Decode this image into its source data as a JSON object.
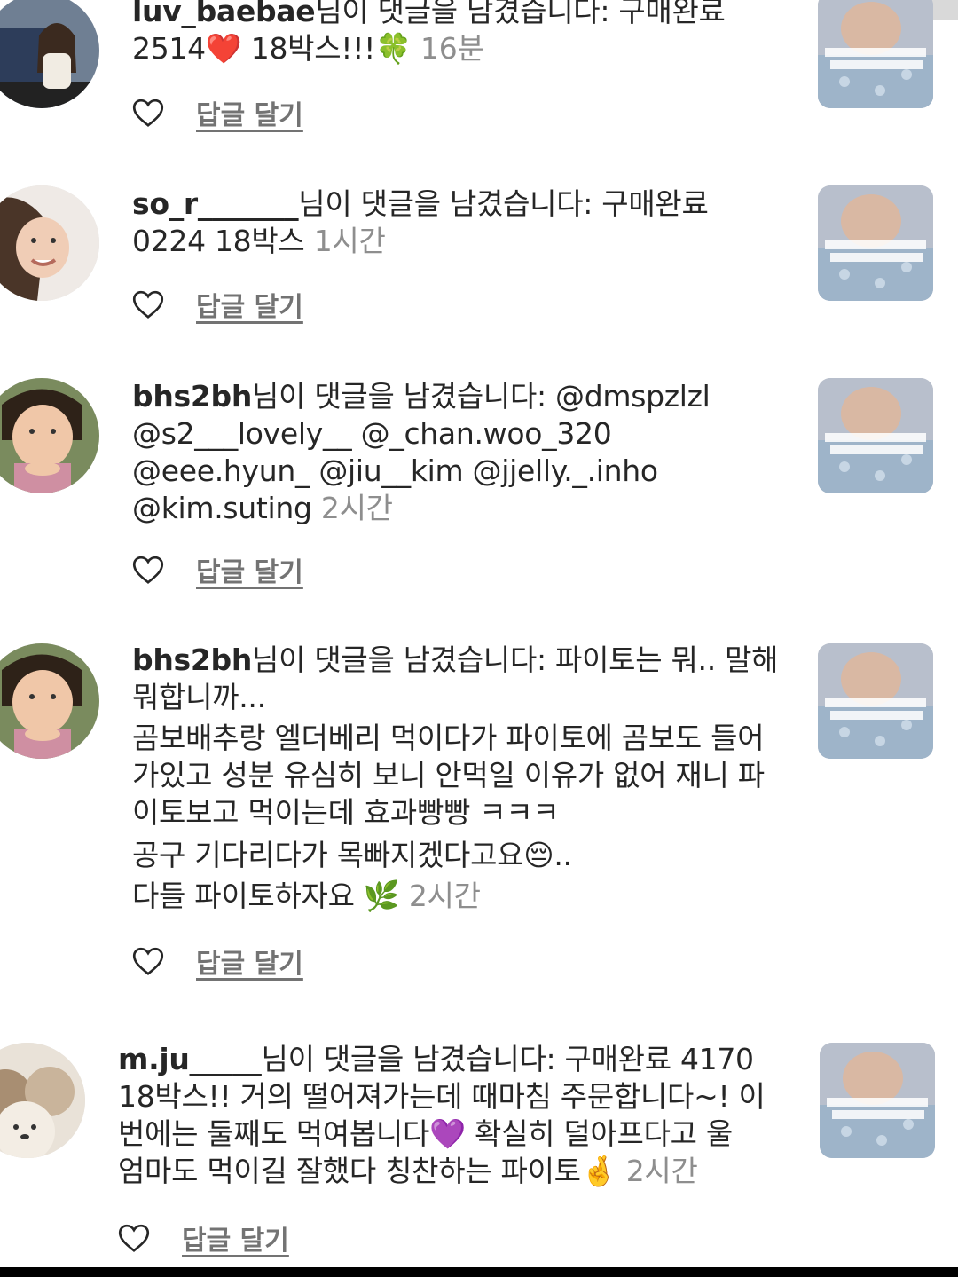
{
  "notifications": [
    {
      "username": "luv_baebae",
      "lines": [
        "님이 댓글을 남겼습니다: 구매완료",
        "2514❤️ 18박스!!!🍀 "
      ],
      "time": "16분",
      "reply_label": "답글 달기",
      "avatar_icon": "woman-car-photo",
      "thumb_icon": "baby-video-thumbnail"
    },
    {
      "username": "so_r_______",
      "lines": [
        "님이 댓글을 남겼습니다: 구매완료",
        "0224 18박스 "
      ],
      "time": "1시간",
      "reply_label": "답글 달기",
      "avatar_icon": "woman-smiling-photo",
      "thumb_icon": "baby-video-thumbnail"
    },
    {
      "username": "bhs2bh",
      "lines": [
        "님이 댓글을 남겼습니다: @dmspzlzl",
        "@s2___lovely__ @_chan.woo_320",
        "@eee.hyun_ @jiu__kim @jjelly._.inho",
        "@kim.suting "
      ],
      "time": "2시간",
      "reply_label": "답글 달기",
      "avatar_icon": "child-photo",
      "thumb_icon": "baby-video-thumbnail"
    },
    {
      "username": "bhs2bh",
      "lines": [
        "님이 댓글을 남겼습니다: 파이토는 뭐.. 말해",
        "뭐합니까...",
        "곰보배추랑 엘더베리 먹이다가 파이토에 곰보도 들어",
        "가있고 성분 유심히 보니 안먹일 이유가 없어 재니 파",
        "이토보고 먹이는데 효과빵빵 ㅋㅋㅋ",
        "공구 기다리다가 목빠지겠다고요😔..",
        "다들 파이토하자요 🌿 "
      ],
      "time": "2시간",
      "reply_label": "답글 달기",
      "avatar_icon": "child-photo",
      "thumb_icon": "baby-video-thumbnail"
    },
    {
      "username": "m.ju_____",
      "lines": [
        "님이 댓글을 남겼습니다: 구매완료 4170",
        "18박스!! 거의 떨어져가는데 때마침 주문합니다~! 이",
        "번에는 둘째도 먹여봅니다💜  확실히 덜아프다고 울",
        "엄마도 먹이길 잘했다 칭찬하는 파이토🤞 "
      ],
      "time": "2시간",
      "reply_label": "답글 달기",
      "avatar_icon": "bear-illustration",
      "thumb_icon": "baby-video-thumbnail"
    }
  ],
  "icons": {
    "like": "heart-outline-icon"
  },
  "colors": {
    "text": "#262626",
    "muted": "#8e8e8e",
    "reply": "#737373"
  }
}
